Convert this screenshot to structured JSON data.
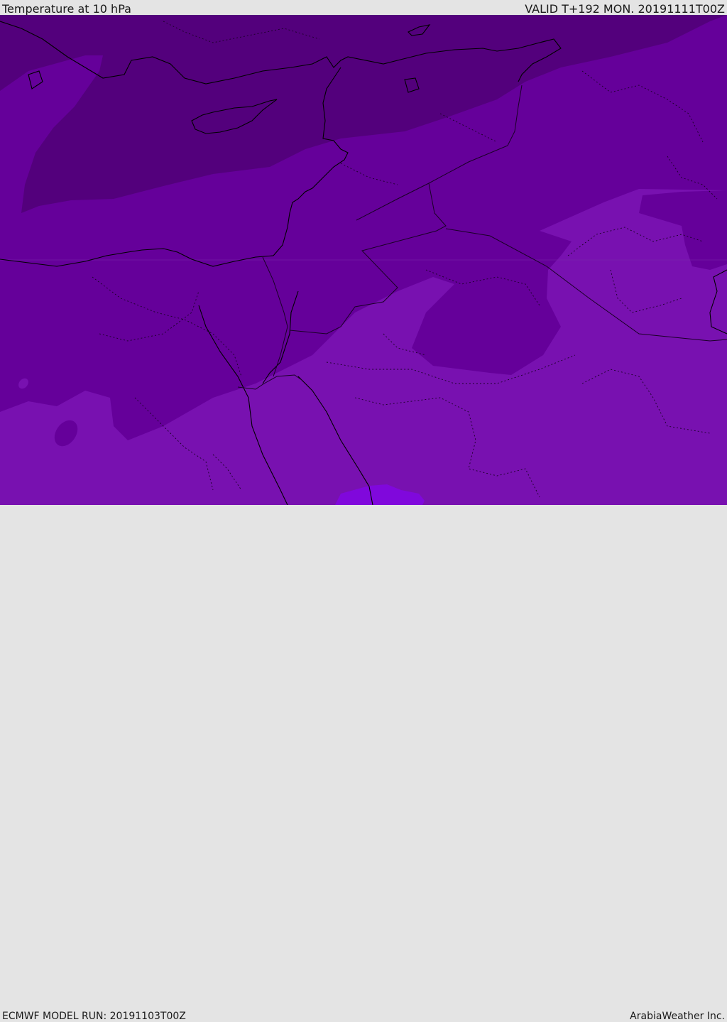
{
  "header": {
    "title": "Temperature at 10 hPa",
    "valid": "VALID T+192 MON. 20191111T00Z"
  },
  "footer": {
    "model_run": "ECMWF MODEL RUN: 20191103T00Z",
    "credit": "ArabiaWeather Inc."
  },
  "map": {
    "field": "temperature",
    "level": "10 hPa",
    "colors": {
      "coldest": "#53007c",
      "cold": "#65009a",
      "mid": "#7811b0",
      "warm": "#8008dc",
      "coast": "#000000",
      "border": "#1a0026"
    }
  }
}
